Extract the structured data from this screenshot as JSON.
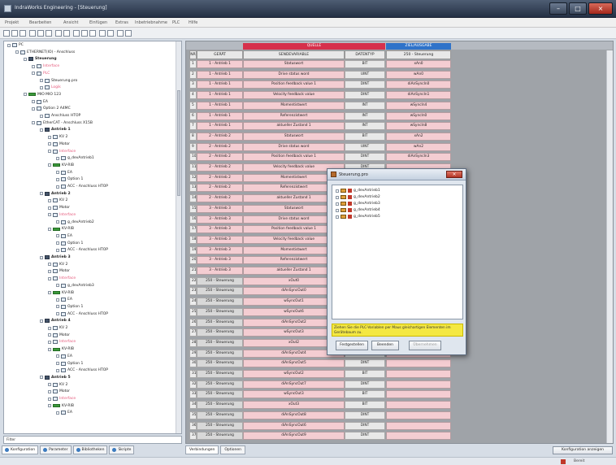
{
  "window": {
    "title": "IndraWorks Engineering - [Steuerung]"
  },
  "menu": [
    "Projekt",
    "Bearbeiten",
    "Ansicht",
    "Einfügen",
    "Extras",
    "Inbetriebnahme",
    "PLC",
    "Hilfe"
  ],
  "tree": {
    "items": [
      {
        "label": "PC",
        "indent": 0,
        "style": "normal"
      },
      {
        "label": "ETHERNET(IO) - Anschluss",
        "indent": 1,
        "style": "normal"
      },
      {
        "label": "Steuerung",
        "indent": 2,
        "style": "bold"
      },
      {
        "label": "Interface",
        "indent": 3,
        "style": "pink"
      },
      {
        "label": "PLC",
        "indent": 3,
        "style": "pink"
      },
      {
        "label": "Steuerung.pro",
        "indent": 4,
        "style": "normal"
      },
      {
        "label": "Logik",
        "indent": 4,
        "style": "pink"
      },
      {
        "label": "MIO MIO 123",
        "indent": 2,
        "style": "normal"
      },
      {
        "label": "EA",
        "indent": 3,
        "style": "normal"
      },
      {
        "label": "Option 2 A4MC",
        "indent": 3,
        "style": "normal"
      },
      {
        "label": "Anschluss HTOP",
        "indent": 4,
        "style": "normal"
      },
      {
        "label": "EtherCAT - Anschluss X15B",
        "indent": 3,
        "style": "normal"
      },
      {
        "label": "Antrieb 1",
        "indent": 4,
        "style": "bold"
      },
      {
        "label": "KV 2",
        "indent": 5,
        "style": "normal"
      },
      {
        "label": "Motor",
        "indent": 5,
        "style": "normal"
      },
      {
        "label": "Interface",
        "indent": 5,
        "style": "pink"
      },
      {
        "label": "g_devAntrieb1",
        "indent": 6,
        "style": "normal"
      },
      {
        "label": "KV-RIB",
        "indent": 5,
        "style": "normal"
      },
      {
        "label": "EA",
        "indent": 6,
        "style": "normal"
      },
      {
        "label": "Option 1",
        "indent": 6,
        "style": "normal"
      },
      {
        "label": "ACC - Anschluss HTOP",
        "indent": 6,
        "style": "normal"
      },
      {
        "label": "Antrieb 2",
        "indent": 4,
        "style": "bold"
      },
      {
        "label": "KV 2",
        "indent": 5,
        "style": "normal"
      },
      {
        "label": "Motor",
        "indent": 5,
        "style": "normal"
      },
      {
        "label": "Interface",
        "indent": 5,
        "style": "pink"
      },
      {
        "label": "g_devAntrieb2",
        "indent": 6,
        "style": "normal"
      },
      {
        "label": "KV-RIB",
        "indent": 5,
        "style": "normal"
      },
      {
        "label": "EA",
        "indent": 6,
        "style": "normal"
      },
      {
        "label": "Option 1",
        "indent": 6,
        "style": "normal"
      },
      {
        "label": "ACC - Anschluss HTOP",
        "indent": 6,
        "style": "normal"
      },
      {
        "label": "Antrieb 3",
        "indent": 4,
        "style": "bold"
      },
      {
        "label": "KV 2",
        "indent": 5,
        "style": "normal"
      },
      {
        "label": "Motor",
        "indent": 5,
        "style": "normal"
      },
      {
        "label": "Interface",
        "indent": 5,
        "style": "pink"
      },
      {
        "label": "g_devAntrieb3",
        "indent": 6,
        "style": "normal"
      },
      {
        "label": "KV-RIB",
        "indent": 5,
        "style": "normal"
      },
      {
        "label": "EA",
        "indent": 6,
        "style": "normal"
      },
      {
        "label": "Option 1",
        "indent": 6,
        "style": "normal"
      },
      {
        "label": "ACC - Anschluss HTOP",
        "indent": 6,
        "style": "normal"
      },
      {
        "label": "Antrieb 4",
        "indent": 4,
        "style": "bold"
      },
      {
        "label": "KV 2",
        "indent": 5,
        "style": "normal"
      },
      {
        "label": "Motor",
        "indent": 5,
        "style": "normal"
      },
      {
        "label": "Interface",
        "indent": 5,
        "style": "pink"
      },
      {
        "label": "KV-RIB",
        "indent": 5,
        "style": "normal"
      },
      {
        "label": "EA",
        "indent": 6,
        "style": "normal"
      },
      {
        "label": "Option 1",
        "indent": 6,
        "style": "normal"
      },
      {
        "label": "ACC - Anschluss HTOP",
        "indent": 6,
        "style": "normal"
      },
      {
        "label": "Antrieb 5",
        "indent": 4,
        "style": "bold"
      },
      {
        "label": "KV 2",
        "indent": 5,
        "style": "normal"
      },
      {
        "label": "Motor",
        "indent": 5,
        "style": "normal"
      },
      {
        "label": "Interface",
        "indent": 5,
        "style": "pink"
      },
      {
        "label": "KV-RIB",
        "indent": 5,
        "style": "normal"
      },
      {
        "label": "EA",
        "indent": 6,
        "style": "normal"
      }
    ]
  },
  "filter_label": "Filter",
  "bottom_tabs": [
    "Konfiguration",
    "Parameter",
    "Bibliotheken",
    "Skripte"
  ],
  "grid": {
    "band_source": "QUELLE",
    "band_target": "ZIEL/AUSGABE",
    "headers": [
      "NR",
      "GERÄT",
      "SENDEVARIABLE",
      "DATENTYP",
      "250 - Steuerung"
    ],
    "rows": [
      [
        "1",
        "1 - Antrieb 1",
        "Statuswort",
        "BIT",
        "xAn0"
      ],
      [
        "2",
        "1 - Antrieb 1",
        "Drive status word",
        "UINT",
        "wAn0"
      ],
      [
        "3",
        "1 - Antrieb 1",
        "Position feedback value 1",
        "DINT",
        "diAnSyncIn0"
      ],
      [
        "4",
        "1 - Antrieb 1",
        "Velocity feedback value",
        "DINT",
        "diAnSyncIn1"
      ],
      [
        "5",
        "1 - Antrieb 1",
        "Momentistwert",
        "INT",
        "wSyncIn4"
      ],
      [
        "6",
        "1 - Antrieb 1",
        "Referenzistwert",
        "INT",
        "wSyncIn0"
      ],
      [
        "7",
        "1 - Antrieb 1",
        "aktueller Zustand 1",
        "INT",
        "wSyncIn8"
      ],
      [
        "8",
        "2 - Antrieb 2",
        "Statuswort",
        "BIT",
        "xAn2"
      ],
      [
        "9",
        "2 - Antrieb 2",
        "Drive status word",
        "UINT",
        "wAn2"
      ],
      [
        "10",
        "2 - Antrieb 2",
        "Position feedback value 1",
        "DINT",
        "diAnSyncIn3"
      ],
      [
        "11",
        "2 - Antrieb 2",
        "Velocity feedback value",
        "DINT",
        ""
      ],
      [
        "12",
        "2 - Antrieb 2",
        "Momentistwert",
        "INT",
        ""
      ],
      [
        "13",
        "2 - Antrieb 2",
        "Referenzistwert",
        "INT",
        ""
      ],
      [
        "14",
        "2 - Antrieb 2",
        "aktueller Zustand 1",
        "INT",
        ""
      ],
      [
        "15",
        "3 - Antrieb 3",
        "Statuswort",
        "BIT",
        ""
      ],
      [
        "16",
        "3 - Antrieb 3",
        "Drive status word",
        "UINT",
        ""
      ],
      [
        "17",
        "3 - Antrieb 3",
        "Position feedback value 1",
        "DINT",
        ""
      ],
      [
        "18",
        "3 - Antrieb 3",
        "Velocity feedback value",
        "DINT",
        ""
      ],
      [
        "19",
        "3 - Antrieb 3",
        "Momentistwert",
        "INT",
        ""
      ],
      [
        "20",
        "3 - Antrieb 3",
        "Referenzistwert",
        "INT",
        ""
      ],
      [
        "21",
        "3 - Antrieb 3",
        "aktueller Zustand 1",
        "INT",
        ""
      ],
      [
        "22",
        "250 - Steuerung",
        "xOut0",
        "BIT",
        ""
      ],
      [
        "23",
        "250 - Steuerung",
        "diAnSyncOut0",
        "DINT",
        ""
      ],
      [
        "24",
        "250 - Steuerung",
        "wSyncOut1",
        "INT",
        ""
      ],
      [
        "25",
        "250 - Steuerung",
        "wSyncOut6",
        "INT",
        ""
      ],
      [
        "26",
        "250 - Steuerung",
        "diAnSyncOut2",
        "DINT",
        ""
      ],
      [
        "27",
        "250 - Steuerung",
        "wSyncOut3",
        "INT",
        ""
      ],
      [
        "28",
        "250 - Steuerung",
        "xOut2",
        "BIT",
        ""
      ],
      [
        "29",
        "250 - Steuerung",
        "diAnSyncOut4",
        "DINT",
        ""
      ],
      [
        "30",
        "250 - Steuerung",
        "diAnSyncOut5",
        "DINT",
        ""
      ],
      [
        "31",
        "250 - Steuerung",
        "wSyncOut2",
        "BIT",
        ""
      ],
      [
        "32",
        "250 - Steuerung",
        "diAnSyncOut7",
        "DINT",
        ""
      ],
      [
        "33",
        "250 - Steuerung",
        "wSyncOut3",
        "BIT",
        ""
      ],
      [
        "34",
        "250 - Steuerung",
        "xOut3",
        "BIT",
        ""
      ],
      [
        "35",
        "250 - Steuerung",
        "diAnSyncOut8",
        "DINT",
        ""
      ],
      [
        "36",
        "250 - Steuerung",
        "diAnSyncOut6",
        "DINT",
        ""
      ],
      [
        "37",
        "250 - Steuerung",
        "diAnSyncOut9",
        "DINT",
        ""
      ]
    ]
  },
  "grid_tabs": [
    "Verbindungen",
    "Optionen"
  ],
  "configure_button": "Konfiguration anzeigen",
  "status_text": "Bereit",
  "dialog": {
    "title": "Steuerung.pro",
    "items": [
      "g_devAntrieb1",
      "g_devAntrieb2",
      "g_devAntrieb3",
      "g_devAntrieb4",
      "g_devAntrieb5"
    ],
    "hint": "Ziehen Sie die PLC-Variablen per Maus gleichartigen Elementen im Gerätebaum zu.",
    "buttons": [
      "Festgestellen",
      "Beenden",
      "Übernehmen"
    ]
  },
  "colors": {
    "band_source": "#d6304b",
    "band_target": "#2f73c9",
    "cell_pink": "#f4cdd2",
    "hint_yellow": "#f4e842"
  },
  "icons": [
    "app-icon",
    "minimize-icon",
    "maximize-icon",
    "close-icon",
    "folder-icon",
    "drive-icon",
    "module-icon",
    "plc-icon"
  ]
}
